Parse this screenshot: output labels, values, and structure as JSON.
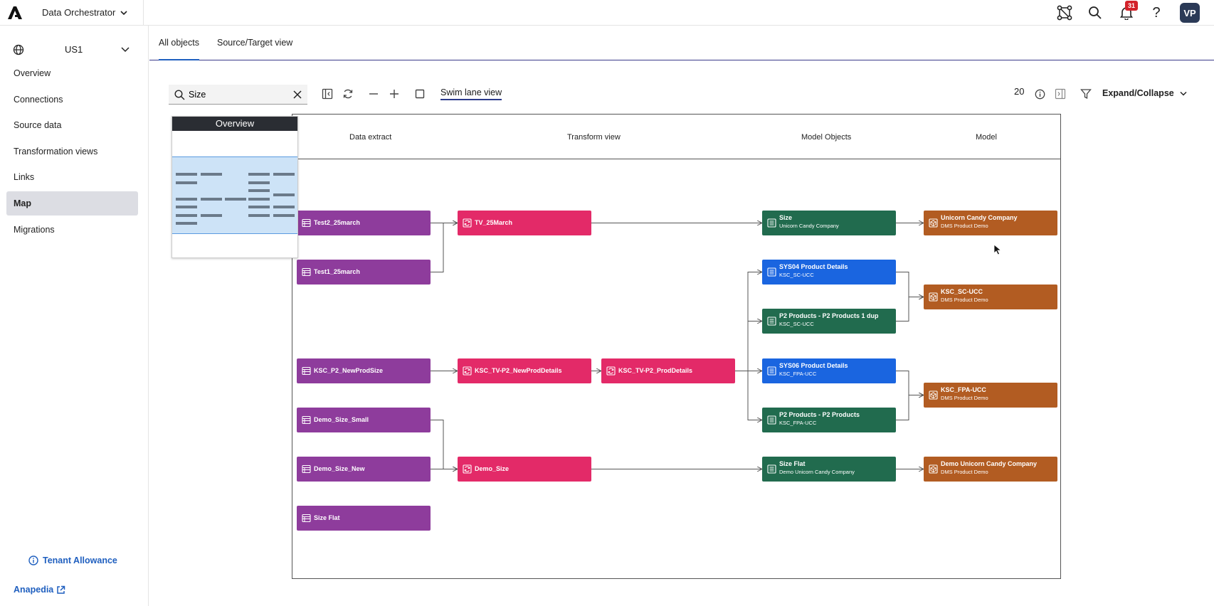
{
  "app": {
    "title": "Data Orchestrator",
    "notification_count": "31",
    "avatar_initials": "VP"
  },
  "sidebar": {
    "region": "US1",
    "items": [
      {
        "label": "Overview"
      },
      {
        "label": "Connections"
      },
      {
        "label": "Source data"
      },
      {
        "label": "Transformation views"
      },
      {
        "label": "Links"
      },
      {
        "label": "Map"
      },
      {
        "label": "Migrations"
      }
    ],
    "active": "Map",
    "tenant_allowance": "Tenant Allowance",
    "anapedia": "Anapedia"
  },
  "tabs": [
    {
      "label": "All objects"
    },
    {
      "label": "Source/Target view"
    }
  ],
  "toolbar": {
    "search_value": "Size",
    "swim_lane": "Swim lane view",
    "count": "20",
    "expand_collapse": "Expand/Collapse"
  },
  "overview": {
    "title": "Overview"
  },
  "lanes": [
    "Data extract",
    "Transform view",
    "Model Objects",
    "Model"
  ],
  "nodes": [
    {
      "id": "n1",
      "lane": "Data extract",
      "title": "Test2_25march",
      "subtitle": "",
      "color": "#8e3c9c"
    },
    {
      "id": "n2",
      "lane": "Data extract",
      "title": "Test1_25march",
      "subtitle": "",
      "color": "#8e3c9c"
    },
    {
      "id": "n3",
      "lane": "Data extract",
      "title": "KSC_P2_NewProdSize",
      "subtitle": "",
      "color": "#8e3c9c"
    },
    {
      "id": "n4",
      "lane": "Data extract",
      "title": "Demo_Size_Small",
      "subtitle": "",
      "color": "#8e3c9c"
    },
    {
      "id": "n5",
      "lane": "Data extract",
      "title": "Demo_Size_New",
      "subtitle": "",
      "color": "#8e3c9c"
    },
    {
      "id": "n6",
      "lane": "Data extract",
      "title": "Size Flat",
      "subtitle": "",
      "color": "#8e3c9c"
    },
    {
      "id": "n7",
      "lane": "Transform view",
      "title": "TV_25March",
      "subtitle": "",
      "color": "#e32a68"
    },
    {
      "id": "n8",
      "lane": "Transform view",
      "title": "KSC_TV-P2_NewProdDetails",
      "subtitle": "",
      "color": "#e32a68"
    },
    {
      "id": "n9",
      "lane": "Transform view",
      "title": "KSC_TV-P2_ProdDetails",
      "subtitle": "",
      "color": "#e32a68"
    },
    {
      "id": "n10",
      "lane": "Transform view",
      "title": "Demo_Size",
      "subtitle": "",
      "color": "#e32a68"
    },
    {
      "id": "n11",
      "lane": "Model Objects",
      "title": "Size",
      "subtitle": "Unicorn Candy Company",
      "color": "#216b4e"
    },
    {
      "id": "n12",
      "lane": "Model Objects",
      "title": "SYS04 Product Details",
      "subtitle": "KSC_SC-UCC",
      "color": "#1a65e0"
    },
    {
      "id": "n13",
      "lane": "Model Objects",
      "title": "P2 Products - P2 Products 1 dup",
      "subtitle": "KSC_SC-UCC",
      "color": "#216b4e"
    },
    {
      "id": "n14",
      "lane": "Model Objects",
      "title": "SYS06 Product Details",
      "subtitle": "KSC_FPA-UCC",
      "color": "#1a65e0"
    },
    {
      "id": "n15",
      "lane": "Model Objects",
      "title": "P2 Products - P2 Products",
      "subtitle": "KSC_FPA-UCC",
      "color": "#216b4e"
    },
    {
      "id": "n16",
      "lane": "Model Objects",
      "title": "Size Flat",
      "subtitle": "Demo Unicorn Candy Company",
      "color": "#216b4e"
    },
    {
      "id": "n17",
      "lane": "Model",
      "title": "Unicorn Candy Company",
      "subtitle": "DMS Product Demo",
      "color": "#b25c22"
    },
    {
      "id": "n18",
      "lane": "Model",
      "title": "KSC_SC-UCC",
      "subtitle": "DMS Product Demo",
      "color": "#b25c22"
    },
    {
      "id": "n19",
      "lane": "Model",
      "title": "KSC_FPA-UCC",
      "subtitle": "DMS Product Demo",
      "color": "#b25c22"
    },
    {
      "id": "n20",
      "lane": "Model",
      "title": "Demo Unicorn Candy Company",
      "subtitle": "DMS Product Demo",
      "color": "#b25c22"
    }
  ],
  "edges": [
    [
      "n1",
      "n7"
    ],
    [
      "n2",
      "n7"
    ],
    [
      "n7",
      "n11"
    ],
    [
      "n11",
      "n17"
    ],
    [
      "n3",
      "n8"
    ],
    [
      "n8",
      "n9"
    ],
    [
      "n9",
      "n12"
    ],
    [
      "n9",
      "n13"
    ],
    [
      "n9",
      "n14"
    ],
    [
      "n9",
      "n15"
    ],
    [
      "n12",
      "n18"
    ],
    [
      "n13",
      "n18"
    ],
    [
      "n14",
      "n19"
    ],
    [
      "n15",
      "n19"
    ],
    [
      "n4",
      "n10"
    ],
    [
      "n5",
      "n10"
    ],
    [
      "n10",
      "n16"
    ],
    [
      "n16",
      "n20"
    ]
  ]
}
